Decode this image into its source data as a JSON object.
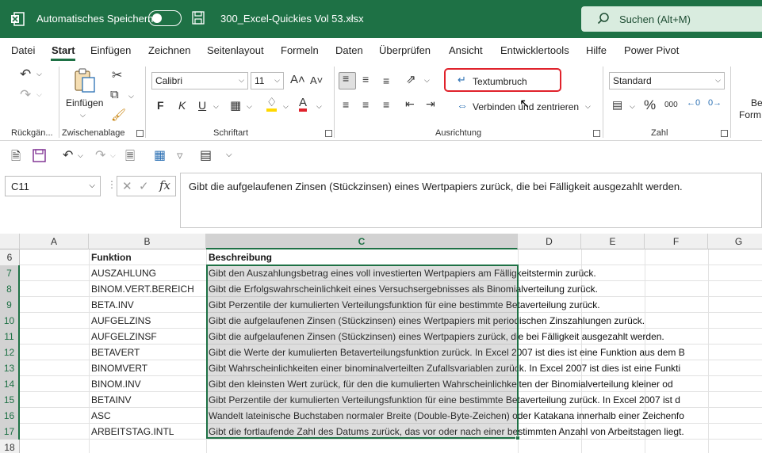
{
  "titlebar": {
    "autosave_label": "Automatisches Speichern",
    "filename": "300_Excel-Quickies Vol 53.xlsx",
    "search_placeholder": "Suchen (Alt+M)"
  },
  "menu": {
    "tabs": [
      "Datei",
      "Start",
      "Einfügen",
      "Zeichnen",
      "Seitenlayout",
      "Formeln",
      "Daten",
      "Überprüfen",
      "Ansicht",
      "Entwicklertools",
      "Hilfe",
      "Power Pivot"
    ],
    "active_tab": "Start"
  },
  "ribbon": {
    "groups": {
      "undo": "Rückgän...",
      "clipboard": "Zwischenablage",
      "font": "Schriftart",
      "alignment": "Ausrichtung",
      "number": "Zahl"
    },
    "paste_label": "Einfügen",
    "font_name": "Calibri",
    "font_size": "11",
    "bold": "F",
    "italic": "K",
    "underline": "U",
    "wrap_text": "Textumbruch",
    "merge_center": "Verbinden und zentrieren",
    "number_format": "Standard",
    "cut_off_1": "Be",
    "cut_off_2": "Form"
  },
  "formula_bar": {
    "name_box": "C11",
    "fx": "fx",
    "content": "Gibt die aufgelaufenen Zinsen (Stückzinsen) eines Wertpapiers zurück, die bei Fälligkeit ausgezahlt werden."
  },
  "grid": {
    "columns": [
      "A",
      "B",
      "C",
      "D",
      "E",
      "F",
      "G"
    ],
    "rows": [
      {
        "num": "6",
        "b": "Funktion",
        "c": "Beschreibung"
      },
      {
        "num": "7",
        "b": "AUSZAHLUNG",
        "c": "Gibt den Auszahlungsbetrag eines voll investierten Wertpapiers am Fälligkeitstermin zurück."
      },
      {
        "num": "8",
        "b": "BINOM.VERT.BEREICH",
        "c": "Gibt die Erfolgswahrscheinlichkeit eines Versuchsergebnisses als Binomialverteilung zurück."
      },
      {
        "num": "9",
        "b": "BETA.INV",
        "c": "Gibt Perzentile der kumulierten Verteilungsfunktion für eine bestimmte Betaverteilung zurück."
      },
      {
        "num": "10",
        "b": "AUFGELZINS",
        "c": "Gibt die aufgelaufenen Zinsen (Stückzinsen) eines Wertpapiers mit periodischen Zinszahlungen zurück."
      },
      {
        "num": "11",
        "b": "AUFGELZINSF",
        "c": "Gibt die aufgelaufenen Zinsen (Stückzinsen) eines Wertpapiers zurück, die bei Fälligkeit ausgezahlt werden."
      },
      {
        "num": "12",
        "b": "BETAVERT",
        "c": "Gibt die Werte der kumulierten Betaverteilungsfunktion zurück. In Excel 2007 ist dies ist eine Funktion aus dem B"
      },
      {
        "num": "13",
        "b": "BINOMVERT",
        "c": "Gibt Wahrscheinlichkeiten einer binominalverteilten Zufallsvariablen zurück. In Excel 2007 ist dies ist eine Funkti"
      },
      {
        "num": "14",
        "b": "BINOM.INV",
        "c": "Gibt den kleinsten Wert zurück, für den die kumulierten Wahrscheinlichkeiten der Binomialverteilung kleiner od"
      },
      {
        "num": "15",
        "b": "BETAINV",
        "c": "Gibt Perzentile der kumulierten Verteilungsfunktion für eine bestimmte Betaverteilung zurück. In Excel 2007 ist d"
      },
      {
        "num": "16",
        "b": "ASC",
        "c": "Wandelt lateinische Buchstaben normaler Breite (Double-Byte-Zeichen) oder Katakana innerhalb einer Zeichenfo"
      },
      {
        "num": "17",
        "b": "ARBEITSTAG.INTL",
        "c": "Gibt die fortlaufende Zahl des Datums zurück, das vor oder nach einer bestimmten Anzahl von Arbeitstagen liegt."
      },
      {
        "num": "18",
        "b": "",
        "c": ""
      }
    ]
  },
  "colors": {
    "excel_green": "#1e7145",
    "highlight_red": "#e0222b"
  }
}
